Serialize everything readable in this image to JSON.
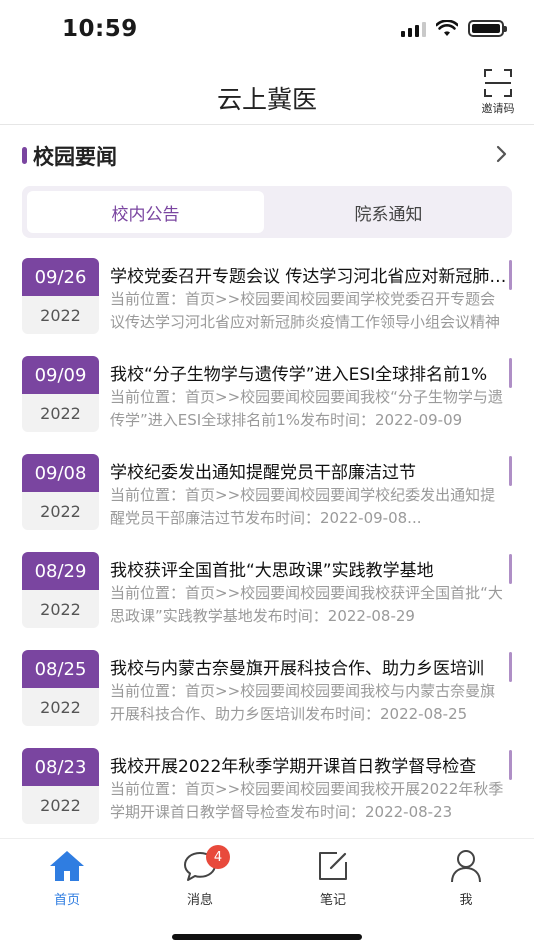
{
  "status_bar": {
    "time": "10:59"
  },
  "header": {
    "title": "云上冀医",
    "invite_label": "邀请码"
  },
  "section": {
    "title": "校园要闻"
  },
  "tabs": [
    {
      "label": "校内公告",
      "active": true
    },
    {
      "label": "院系通知",
      "active": false
    }
  ],
  "news": [
    {
      "date": "09/26",
      "year": "2022",
      "title": "学校党委召开专题会议 传达学习河北省应对新冠肺炎疫情工作领导小组会议精神",
      "summary": "当前位置：首页>>校园要闻校园要闻学校党委召开专题会议传达学习河北省应对新冠肺炎疫情工作领导小组会议精神"
    },
    {
      "date": "09/09",
      "year": "2022",
      "title": "我校“分子生物学与遗传学”进入ESI全球排名前1%",
      "summary": "当前位置：首页>>校园要闻校园要闻我校“分子生物学与遗传学”进入ESI全球排名前1%发布时间：2022-09-09"
    },
    {
      "date": "09/08",
      "year": "2022",
      "title": "学校纪委发出通知提醒党员干部廉洁过节",
      "summary": "当前位置：首页>>校园要闻校园要闻学校纪委发出通知提醒党员干部廉洁过节发布时间：2022-09-08..."
    },
    {
      "date": "08/29",
      "year": "2022",
      "title": "我校获评全国首批“大思政课”实践教学基地",
      "summary": "当前位置：首页>>校园要闻校园要闻我校获评全国首批“大思政课”实践教学基地发布时间：2022-08-29"
    },
    {
      "date": "08/25",
      "year": "2022",
      "title": "我校与内蒙古奈曼旗开展科技合作、助力乡医培训",
      "summary": "当前位置：首页>>校园要闻校园要闻我校与内蒙古奈曼旗开展科技合作、助力乡医培训发布时间：2022-08-25"
    },
    {
      "date": "08/23",
      "year": "2022",
      "title": "我校开展2022年秋季学期开课首日教学督导检查",
      "summary": "当前位置：首页>>校园要闻校园要闻我校开展2022年秋季学期开课首日教学督导检查发布时间：2022-08-23"
    }
  ],
  "bottom_nav": [
    {
      "label": "首页",
      "icon": "home-icon",
      "active": true
    },
    {
      "label": "消息",
      "icon": "message-icon",
      "badge": "4"
    },
    {
      "label": "笔记",
      "icon": "notes-icon"
    },
    {
      "label": "我",
      "icon": "profile-icon"
    }
  ],
  "colors": {
    "accent": "#7a45a0",
    "nav_active": "#2f7de1",
    "badge": "#e84a3c"
  }
}
